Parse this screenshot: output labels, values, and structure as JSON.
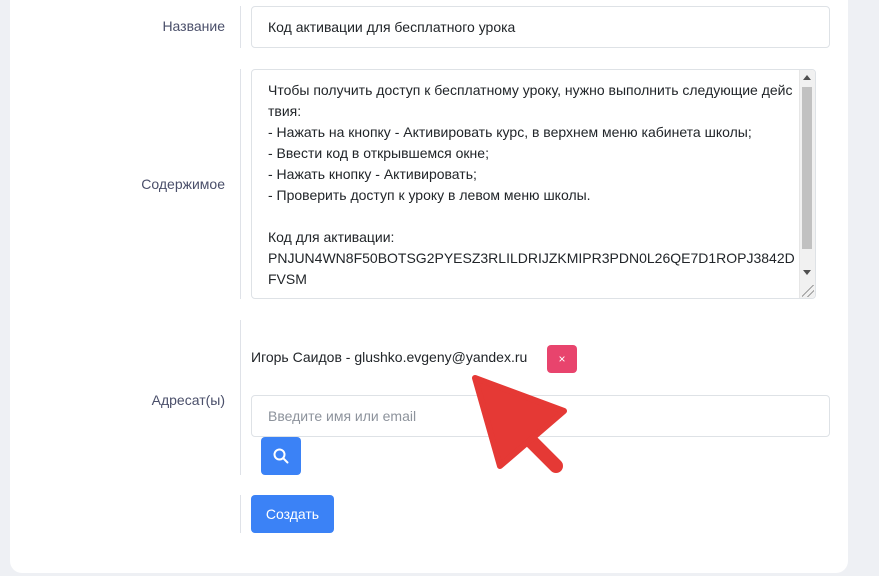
{
  "form": {
    "title": {
      "label": "Название",
      "value": "Код активации для бесплатного урока"
    },
    "content": {
      "label": "Содержимое",
      "value": "Чтобы получить доступ к бесплатному уроку, нужно выполнить следующие действия:\n- Нажать на кнопку - Активировать курс, в верхнем меню кабинета школы;\n- Ввести код в открывшемся окне;\n- Нажать кнопку - Активировать;\n- Проверить доступ к уроку в левом меню школы.\n\nКод для активации:\nPNJUN4WN8F50BOTSG2PYESZ3RLILDRIJZKMIPR3PDN0L26QE7D1ROPJ3842DFVSM"
    },
    "recipients": {
      "label": "Адресат(ы)",
      "selected": "Игорь Саидов - glushko.evgeny@yandex.ru",
      "remove_label": "×",
      "search_placeholder": "Введите имя или email"
    },
    "submit_label": "Создать"
  },
  "colors": {
    "primary": "#3b82f6",
    "danger": "#e8446d",
    "annotation_arrow": "#e53935"
  },
  "icons": {
    "search": "search-icon",
    "remove": "close-icon",
    "annotation": "red-arrow-annotation"
  }
}
